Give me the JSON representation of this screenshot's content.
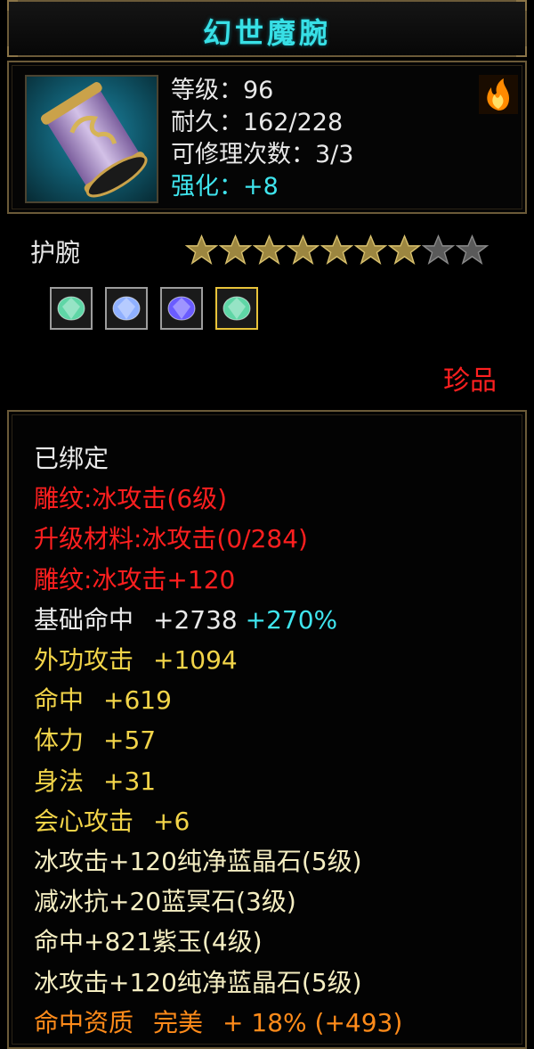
{
  "title": "幻世魔腕",
  "header": {
    "item_icon": "bracer-icon",
    "level": "等级：96",
    "durability": "耐久：162/228",
    "repairs": "可修理次数：3/3",
    "enhance": "强化：+8",
    "quality_icon": "flame-icon"
  },
  "item_type": "护腕",
  "stars": {
    "filled": 7,
    "total": 9
  },
  "gems": [
    {
      "name": "green-gem-icon",
      "color": "#5fd6a6"
    },
    {
      "name": "blue-gem-icon",
      "color": "#8fb0ff"
    },
    {
      "name": "purple-gem-icon",
      "color": "#6a5cff"
    },
    {
      "name": "green-gem-icon",
      "color": "#5fd6a6",
      "selected": true
    }
  ],
  "rarity": "珍品",
  "attributes": {
    "bound": "已绑定",
    "carving1": "雕纹:冰攻击(6级)",
    "upgrade_material": "升级材料:冰攻击(0/284)",
    "carving2": "雕纹:冰攻击+120",
    "base_hit_label": "基础命中",
    "base_hit_value": "+2738",
    "base_hit_bonus": "+270%",
    "ext_attack_label": "外功攻击",
    "ext_attack_value": "+1094",
    "hit_label": "命中",
    "hit_value": "+619",
    "stamina_label": "体力",
    "stamina_value": "+57",
    "agility_label": "身法",
    "agility_value": "+31",
    "crit_label": "会心攻击",
    "crit_value": "+6",
    "gem1": "冰攻击+120纯净蓝晶石(5级)",
    "gem2": "减冰抗+20蓝冥石(3级)",
    "gem3": "命中+821紫玉(4级)",
    "gem4": "冰攻击+120纯净蓝晶石(5级)",
    "aptitude_label": "命中资质",
    "aptitude_grade": "完美",
    "aptitude_value": "+ 18% (+493)"
  }
}
